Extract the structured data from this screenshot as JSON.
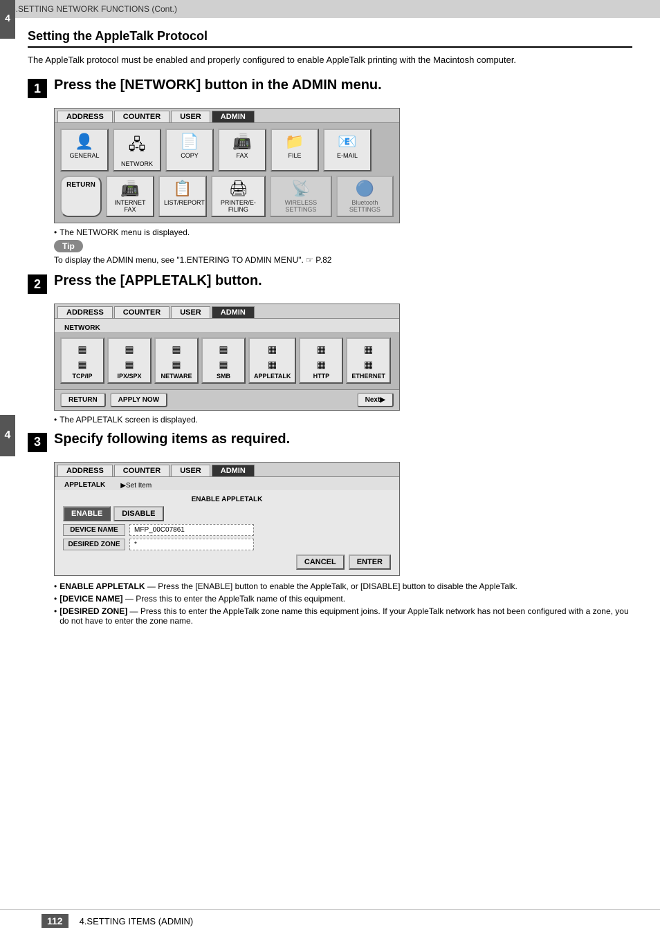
{
  "topBar": {
    "text": "3.SETTING NETWORK FUNCTIONS (Cont.)"
  },
  "bottomBar": {
    "pageNumber": "112",
    "text": "4.SETTING ITEMS (ADMIN)"
  },
  "chapterTab": "4",
  "sectionTitle": "Setting the AppleTalk Protocol",
  "sectionIntro": "The AppleTalk protocol must be enabled and properly configured to enable AppleTalk printing with the Macintosh computer.",
  "steps": [
    {
      "num": "1",
      "label": "Press the [NETWORK] button in the ADMIN menu.",
      "bulletNote": "The NETWORK menu is displayed.",
      "tipLabel": "Tip",
      "tipText": "To display the ADMIN menu, see \"1.ENTERING TO ADMIN MENU\".  ☞ P.82"
    },
    {
      "num": "2",
      "label": "Press the [APPLETALK] button.",
      "bulletNote": "The APPLETALK screen is displayed."
    },
    {
      "num": "3",
      "label": "Specify following items as required."
    }
  ],
  "panel1": {
    "tabs": [
      "ADDRESS",
      "COUNTER",
      "USER",
      "ADMIN"
    ],
    "activeTab": "ADMIN",
    "buttons": [
      {
        "label": "GENERAL",
        "icon": "👤"
      },
      {
        "label": "NETWORK",
        "icon": "🖧"
      },
      {
        "label": "COPY",
        "icon": "📄"
      },
      {
        "label": "FAX",
        "icon": "📠"
      },
      {
        "label": "FILE",
        "icon": "📁"
      },
      {
        "label": "E-MAIL",
        "icon": "📧"
      },
      {
        "label": "INTERNET FAX",
        "icon": "📠"
      },
      {
        "label": "LIST/REPORT",
        "icon": "📋"
      },
      {
        "label": "PRINTER/E-FILING",
        "icon": "🖨"
      },
      {
        "label": "WIRELESS SETTINGS",
        "icon": "📡"
      },
      {
        "label": "Bluetooth SETTINGS",
        "icon": "🔵"
      }
    ],
    "returnBtn": "RETURN"
  },
  "panel2": {
    "tabs": [
      "ADDRESS",
      "COUNTER",
      "USER",
      "ADMIN"
    ],
    "activeTab": "ADMIN",
    "networkLabel": "NETWORK",
    "buttons": [
      {
        "label": "TCP/IP",
        "lines": [
          "xxx.xxx",
          "xxx.xxx"
        ]
      },
      {
        "label": "IPX/SPX",
        "lines": [
          "xxxxxx.",
          "xxxxxx."
        ]
      },
      {
        "label": "NETWARE",
        "lines": [
          "xxx.xx",
          "xxx.xxx"
        ]
      },
      {
        "label": "SMB",
        "lines": [
          "xxx.xxx",
          "xxx.xxx"
        ]
      },
      {
        "label": "APPLETALK",
        "lines": [
          "xxxxx.",
          "xxxxx."
        ]
      },
      {
        "label": "HTTP",
        "lines": [
          "xxxxx.",
          "xxxxx."
        ]
      },
      {
        "label": "ETHERNET",
        "lines": [
          "xxx.xx",
          "xxx.xxx"
        ]
      }
    ],
    "returnBtn": "RETURN",
    "applyNowBtn": "APPLY NOW",
    "nextBtn": "Next▶"
  },
  "panel3": {
    "tabs": [
      "ADDRESS",
      "COUNTER",
      "USER",
      "ADMIN"
    ],
    "activeTab": "ADMIN",
    "networkLabel": "APPLETALK",
    "setItem": "▶Set Item",
    "enableHeader": "ENABLE APPLETALK",
    "enableBtn": "ENABLE",
    "disableBtn": "DISABLE",
    "deviceNameLabel": "DEVICE NAME",
    "deviceNameValue": "MFP_00C07861",
    "desiredZoneLabel": "DESIRED ZONE",
    "desiredZoneValue": "*",
    "cancelBtn": "CANCEL",
    "enterBtn": "ENTER"
  },
  "descItems": [
    {
      "bullet": "•",
      "text": "ENABLE APPLETALK — Press the [ENABLE] button to enable the AppleTalk, or [DISABLE] button to disable the AppleTalk."
    },
    {
      "bullet": "•",
      "text": "[DEVICE NAME] — Press this to enter the AppleTalk name of this equipment."
    },
    {
      "bullet": "•",
      "text": "[DESIRED ZONE] — Press this to enter the AppleTalk zone name this equipment joins.  If your AppleTalk network has not been configured with a zone, you do not have to enter the zone name."
    }
  ]
}
